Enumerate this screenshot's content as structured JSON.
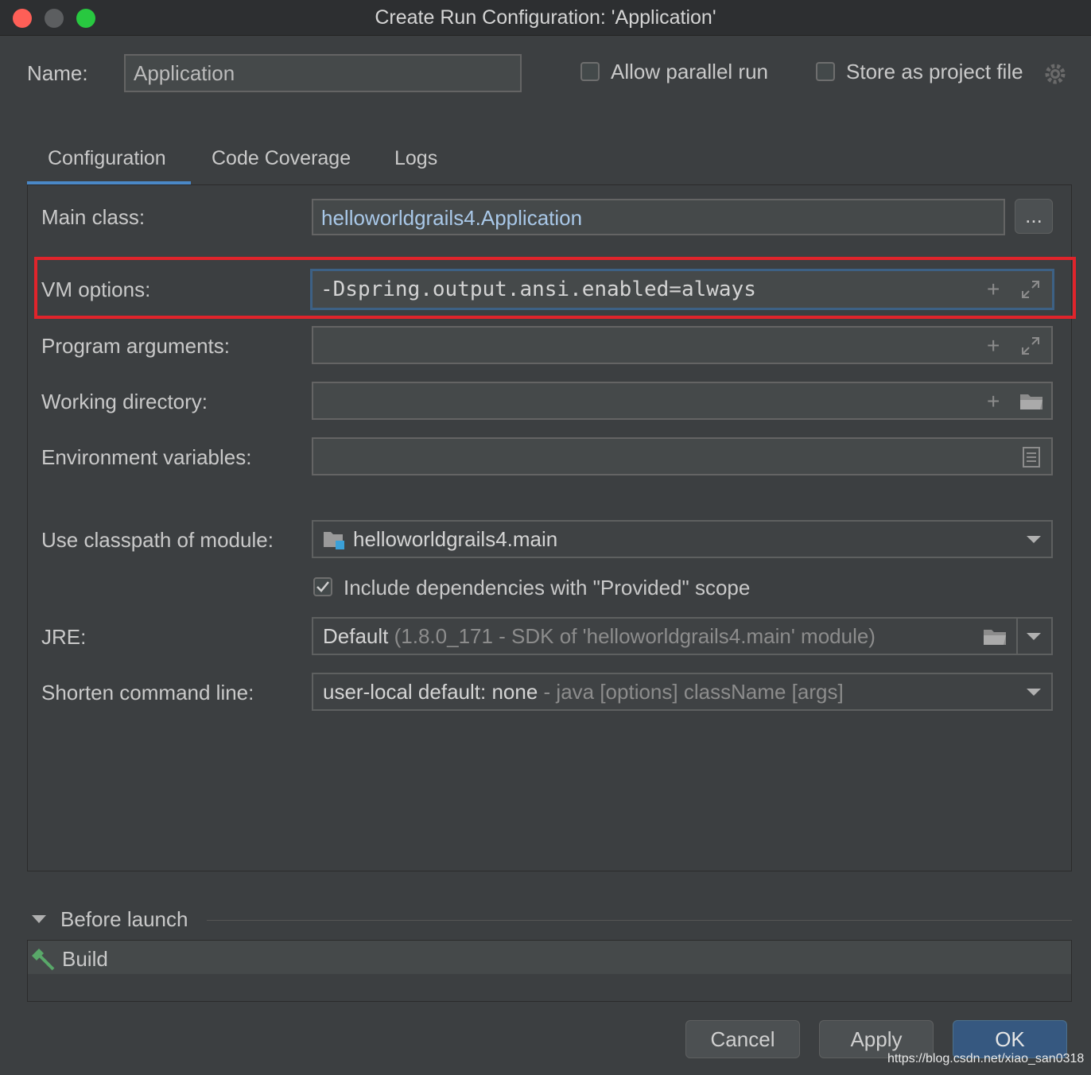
{
  "window": {
    "title": "Create Run Configuration: 'Application'"
  },
  "header": {
    "name_label": "Name:",
    "name_value": "Application",
    "allow_parallel_label": "Allow parallel run",
    "store_project_label": "Store as project file"
  },
  "tabs": [
    {
      "label": "Configuration",
      "active": true
    },
    {
      "label": "Code Coverage",
      "active": false
    },
    {
      "label": "Logs",
      "active": false
    }
  ],
  "form": {
    "main_class": {
      "label": "Main class:",
      "value": "helloworldgrails4.Application",
      "browse": "..."
    },
    "vm_options": {
      "label": "VM options:",
      "value": "-Dspring.output.ansi.enabled=always"
    },
    "program_args": {
      "label": "Program arguments:",
      "value": ""
    },
    "working_dir": {
      "label": "Working directory:",
      "value": ""
    },
    "env_vars": {
      "label": "Environment variables:",
      "value": ""
    },
    "classpath": {
      "label": "Use classpath of module:",
      "value": "helloworldgrails4.main"
    },
    "include_deps": {
      "label": "Include dependencies with \"Provided\" scope",
      "checked": true
    },
    "jre": {
      "label": "JRE:",
      "value": "Default",
      "hint": "(1.8.0_171 - SDK of 'helloworldgrails4.main' module)"
    },
    "shorten": {
      "label": "Shorten command line:",
      "value": "user-local default: none",
      "hint": "- java [options] className [args]"
    }
  },
  "before_launch": {
    "title": "Before launch",
    "items": [
      {
        "label": "Build"
      }
    ]
  },
  "buttons": {
    "cancel": "Cancel",
    "apply": "Apply",
    "ok": "OK"
  },
  "watermark": "https://blog.csdn.net/xiao_san0318",
  "colors": {
    "accent": "#4a88c7",
    "highlight_box": "#e0242b",
    "primary_button": "#365880",
    "build_icon": "#59a869"
  }
}
